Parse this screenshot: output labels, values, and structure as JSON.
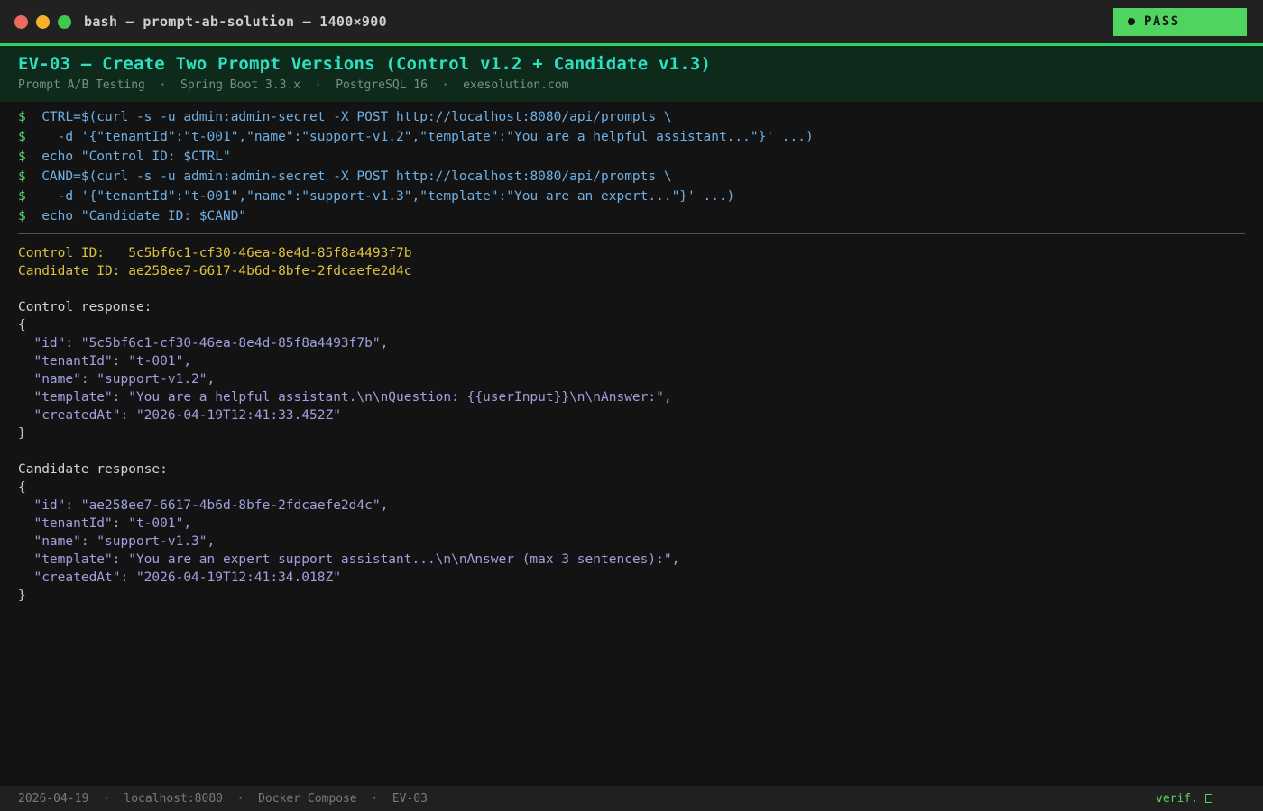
{
  "palette": {
    "accent_green": "#2bd565",
    "badge_green": "#4fd45f",
    "title_cyan": "#2ce0c2",
    "command_blue": "#6fb1e6",
    "prompt_green": "#55d06a",
    "id_yellow": "#dcc13f",
    "json_purple": "#9fa0de",
    "header_bg": "#0d2a1b",
    "terminal_bg": "#131313"
  },
  "window": {
    "title": "bash — prompt-ab-solution — 1400×900",
    "badge": {
      "label": "PASS"
    }
  },
  "header": {
    "title": "EV-03 — Create Two Prompt Versions (Control v1.2 + Candidate v1.3)",
    "subtitle": "Prompt A/B Testing  ·  Spring Boot 3.3.x  ·  PostgreSQL 16  ·  exesolution.com"
  },
  "terminal": {
    "commands": [
      {
        "prompt": "$",
        "text": "  CTRL=$(curl -s -u admin:admin-secret -X POST http://localhost:8080/api/prompts \\"
      },
      {
        "prompt": "$",
        "text": "    -d '{\"tenantId\":\"t-001\",\"name\":\"support-v1.2\",\"template\":\"You are a helpful assistant...\"}' ...)"
      },
      {
        "prompt": "$",
        "text": "  echo \"Control ID: $CTRL\""
      },
      {
        "prompt": "$",
        "text": "  CAND=$(curl -s -u admin:admin-secret -X POST http://localhost:8080/api/prompts \\"
      },
      {
        "prompt": "$",
        "text": "    -d '{\"tenantId\":\"t-001\",\"name\":\"support-v1.3\",\"template\":\"You are an expert...\"}' ...)"
      },
      {
        "prompt": "$",
        "text": "  echo \"Candidate ID: $CAND\""
      }
    ],
    "ids": [
      "Control ID:   5c5bf6c1-cf30-46ea-8e4d-85f8a4493f7b",
      "Candidate ID: ae258ee7-6617-4b6d-8bfe-2fdcaefe2d4c"
    ],
    "control": {
      "label": "Control response:",
      "lines": [
        "{",
        "  \"id\": \"5c5bf6c1-cf30-46ea-8e4d-85f8a4493f7b\",",
        "  \"tenantId\": \"t-001\",",
        "  \"name\": \"support-v1.2\",",
        "  \"template\": \"You are a helpful assistant.\\n\\nQuestion: {{userInput}}\\n\\nAnswer:\",",
        "  \"createdAt\": \"2026-04-19T12:41:33.452Z\"",
        "}"
      ]
    },
    "candidate": {
      "label": "Candidate response:",
      "lines": [
        "{",
        "  \"id\": \"ae258ee7-6617-4b6d-8bfe-2fdcaefe2d4c\",",
        "  \"tenantId\": \"t-001\",",
        "  \"name\": \"support-v1.3\",",
        "  \"template\": \"You are an expert support assistant...\\n\\nAnswer (max 3 sentences):\",",
        "  \"createdAt\": \"2026-04-19T12:41:34.018Z\"",
        "}"
      ]
    }
  },
  "footer": {
    "left": "2026-04-19  ·  localhost:8080  ·  Docker Compose  ·  EV-03",
    "right": "verif."
  }
}
